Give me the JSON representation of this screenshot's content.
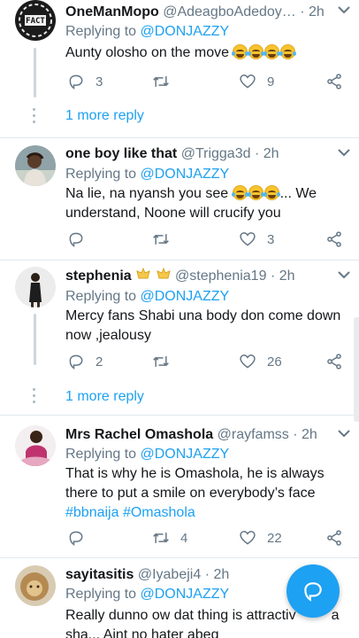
{
  "tweets": [
    {
      "name": "OneManMopo",
      "handle": "@AdeagboAdedoy…",
      "time": "2h",
      "replying_label": "Replying to",
      "replying_to": "@DONJAZZY",
      "text": "Aunty olosho on the move",
      "emoji_count": 4,
      "replies": "3",
      "retweets": "",
      "likes": "9",
      "avatar": "fact-logo",
      "more_replies": "1 more reply"
    },
    {
      "name": "one boy like that",
      "handle": "@Trigga3d",
      "time": "2h",
      "replying_label": "Replying to",
      "replying_to": "@DONJAZZY",
      "text_before": "Na lie, na nyansh you see",
      "text_after": "...  We understand,  Noone will crucify you",
      "emoji_count": 3,
      "replies": "",
      "retweets": "",
      "likes": "3",
      "avatar": "person-photo"
    },
    {
      "name": "stephenia",
      "handle": "@stephenia19",
      "time": "2h",
      "replying_label": "Replying to",
      "replying_to": "@DONJAZZY",
      "text": "Mercy fans Shabi una body don come down now ,jealousy",
      "replies": "2",
      "retweets": "",
      "likes": "26",
      "avatar": "person-photo",
      "more_replies": "1 more reply"
    },
    {
      "name": "Mrs Rachel Omashola",
      "handle": "@rayfamss",
      "time": "2h",
      "replying_label": "Replying to",
      "replying_to": "@DONJAZZY",
      "text": "That is why he is Omashola, he is always there to put a smile on everybody’s face",
      "hashtags": [
        "#bbnaija",
        "#Omashola"
      ],
      "replies": "",
      "retweets": "4",
      "likes": "22",
      "avatar": "person-photo"
    },
    {
      "name": "sayitasitis",
      "handle": "@Iyabeji4",
      "time": "2h",
      "replying_label": "Replying to",
      "replying_to": "@DONJAZZY",
      "text": "Really dunno ow dat thing is attractiv",
      "text_tail": "a",
      "text_line2": "sha... Aint no hater abeg",
      "avatar": "lion-photo"
    }
  ],
  "separator": "·",
  "colors": {
    "accent": "#1da1f2",
    "muted": "#657786",
    "text": "#14171a",
    "border": "#e1e8ed"
  },
  "icons": {
    "reply": "reply-icon",
    "retweet": "retweet-icon",
    "like": "heart-icon",
    "share": "share-icon",
    "caret": "chevron-down-icon",
    "compose": "compose-reply-icon"
  }
}
